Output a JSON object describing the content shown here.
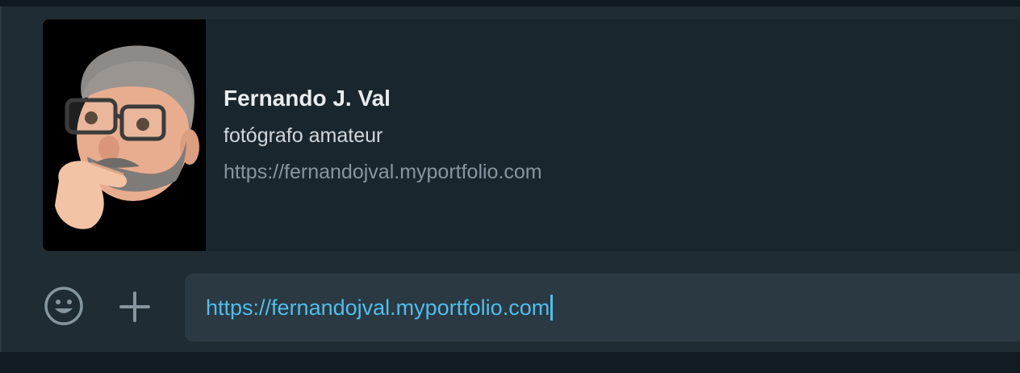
{
  "link_preview": {
    "title": "Fernando J. Val",
    "description": "fotógrafo amateur",
    "url": "https://fernandojval.myportfolio.com",
    "thumbnail": "memoji-avatar"
  },
  "composer": {
    "text": "https://fernandojval.myportfolio.com",
    "emoji_icon": "smiley-icon",
    "attach_icon": "plus-icon"
  },
  "colors": {
    "panel_bg": "#1f2c33",
    "input_bg": "#2a3942",
    "link_color": "#53bdeb",
    "icon_color": "#8696a0"
  }
}
